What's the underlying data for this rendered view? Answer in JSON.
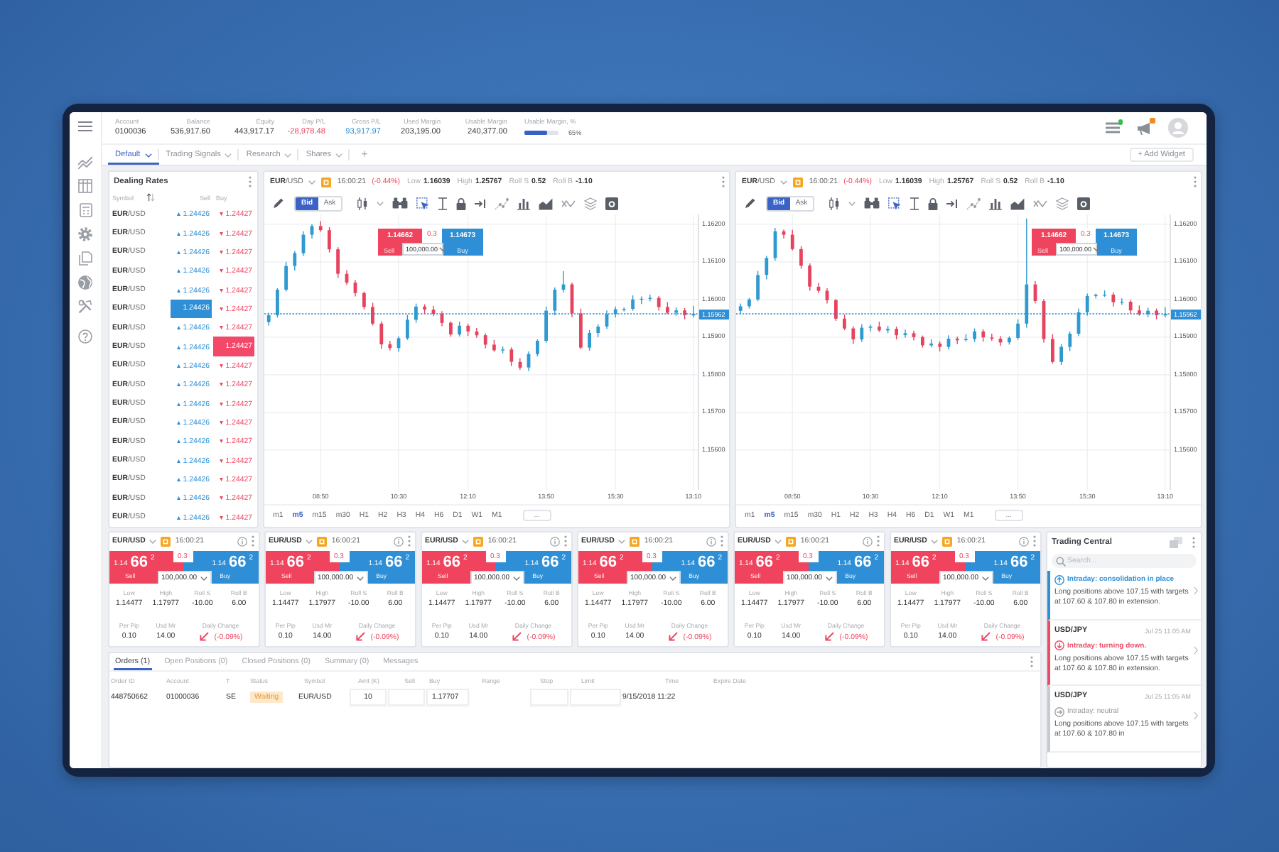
{
  "account_summary": {
    "items": [
      {
        "label": "Account",
        "value": "0100036",
        "color": "#3a3d42"
      },
      {
        "label": "Balance",
        "value": "536,917.60",
        "color": "#3a3d42"
      },
      {
        "label": "Equity",
        "value": "443,917.17",
        "color": "#3a3d42"
      },
      {
        "label": "Day P/L",
        "value": "-28,978.48",
        "color": "#ec4862"
      },
      {
        "label": "Gross P/L",
        "value": "93,917.97",
        "color": "#2f8fd6"
      },
      {
        "label": "Used Margin",
        "value": "203,195.00",
        "color": "#3a3d42"
      },
      {
        "label": "Usable Margin",
        "value": "240,377.00",
        "color": "#3a3d42"
      }
    ],
    "margin_meter": {
      "label": "Usable Margin, %",
      "level": 0.65,
      "reading": "65%"
    }
  },
  "header": {
    "connected": true,
    "unread": true
  },
  "workspace_tabs": [
    {
      "label": "Default",
      "selected": true
    },
    {
      "label": "Trading Signals",
      "selected": false
    },
    {
      "label": "Research",
      "selected": false
    },
    {
      "label": "Shares",
      "selected": false
    }
  ],
  "new_tab": "+",
  "add_widget": "+ Add Widget",
  "dealing_rates": {
    "title": "Dealing Rates",
    "columns": [
      "Symbol",
      "Sell",
      "Buy"
    ],
    "rows": [
      {
        "symbol": "**EUR**/USD",
        "sell": "▴ 1.24426",
        "buy": "▾ 1.24427",
        "sell_highlighted": false,
        "buy_highlighted": false
      },
      {
        "symbol": "**EUR**/USD",
        "sell": "▴ 1.24426",
        "buy": "▾ 1.24427",
        "sell_highlighted": false,
        "buy_highlighted": false
      },
      {
        "symbol": "**EUR**/USD",
        "sell": "▴ 1.24426",
        "buy": "▾ 1.24427",
        "sell_highlighted": false,
        "buy_highlighted": false
      },
      {
        "symbol": "**EUR**/USD",
        "sell": "▴ 1.24426",
        "buy": "▾ 1.24427",
        "sell_highlighted": false,
        "buy_highlighted": false
      },
      {
        "symbol": "**EUR**/USD",
        "sell": "▴ 1.24426",
        "buy": "▾ 1.24427",
        "sell_highlighted": false,
        "buy_highlighted": false
      },
      {
        "symbol": "**EUR**/USD",
        "sell": "1.24426",
        "buy": "▾ 1.24427",
        "sell_highlighted": true,
        "buy_highlighted": false
      },
      {
        "symbol": "**EUR**/USD",
        "sell": "▴ 1.24426",
        "buy": "▾ 1.24427",
        "sell_highlighted": false,
        "buy_highlighted": false
      },
      {
        "symbol": "**EUR**/USD",
        "sell": "▴ 1.24426",
        "buy": "1.24427",
        "sell_highlighted": false,
        "buy_highlighted": true
      },
      {
        "symbol": "**EUR**/USD",
        "sell": "▴ 1.24426",
        "buy": "▾ 1.24427",
        "sell_highlighted": false,
        "buy_highlighted": false
      },
      {
        "symbol": "**EUR**/USD",
        "sell": "▴ 1.24426",
        "buy": "▾ 1.24427",
        "sell_highlighted": false,
        "buy_highlighted": false
      },
      {
        "symbol": "**EUR**/USD",
        "sell": "▴ 1.24426",
        "buy": "▾ 1.24427",
        "sell_highlighted": false,
        "buy_highlighted": false
      },
      {
        "symbol": "**EUR**/USD",
        "sell": "▴ 1.24426",
        "buy": "▾ 1.24427",
        "sell_highlighted": false,
        "buy_highlighted": false
      },
      {
        "symbol": "**EUR**/USD",
        "sell": "▴ 1.24426",
        "buy": "▾ 1.24427",
        "sell_highlighted": false,
        "buy_highlighted": false
      },
      {
        "symbol": "**EUR**/USD",
        "sell": "▴ 1.24426",
        "buy": "▾ 1.24427",
        "sell_highlighted": false,
        "buy_highlighted": false
      },
      {
        "symbol": "**EUR**/USD",
        "sell": "▴ 1.24426",
        "buy": "▾ 1.24427",
        "sell_highlighted": false,
        "buy_highlighted": false
      },
      {
        "symbol": "**EUR**/USD",
        "sell": "▴ 1.24426",
        "buy": "▾ 1.24427",
        "sell_highlighted": false,
        "buy_highlighted": false
      },
      {
        "symbol": "**EUR**/USD",
        "sell": "▴ 1.24426",
        "buy": "▾ 1.24427",
        "sell_highlighted": false,
        "buy_highlighted": false
      }
    ]
  },
  "charts": [
    {
      "pair": "**EUR**/USD",
      "time": "16:00:21",
      "change": {
        "text": "(-0.44%)",
        "falling": true
      },
      "stats": [
        {
          "label": "Low",
          "value": "1.16039"
        },
        {
          "label": "High",
          "value": "1.25767"
        },
        {
          "label": "Roll S",
          "value": "0.52"
        },
        {
          "label": "Roll B",
          "value": "-1.10"
        }
      ],
      "price_types": [
        {
          "label": "Bid",
          "selected": true
        },
        {
          "label": "Ask",
          "selected": false
        }
      ],
      "quote": {
        "sell": "1.14662",
        "spread": "0.3",
        "buy": "1.14673",
        "amount": "100,000.00",
        "sell_label": "Sell",
        "buy_label": "Buy"
      },
      "chart_data": {
        "type": "candlestick",
        "grid": true,
        "categories": [
          null,
          null,
          null,
          null,
          null,
          null,
          "08:50",
          null,
          null,
          null,
          null,
          null,
          null,
          null,
          null,
          "10:30",
          null,
          null,
          null,
          null,
          null,
          null,
          null,
          "12:10",
          null,
          null,
          null,
          null,
          null,
          null,
          null,
          null,
          "13:50",
          null,
          null,
          null,
          null,
          null,
          null,
          null,
          "15:30",
          null,
          null,
          null,
          null,
          null,
          null,
          null,
          null,
          "13:10"
        ],
        "ohlc": [
          [
            1.1594,
            1.15965,
            1.15931,
            1.15958
          ],
          [
            1.15958,
            1.1603,
            1.15952,
            1.16026
          ],
          [
            1.16026,
            1.161,
            1.16021,
            1.16089
          ],
          [
            1.16089,
            1.16129,
            1.16077,
            1.16123
          ],
          [
            1.16123,
            1.16181,
            1.16116,
            1.16172
          ],
          [
            1.16172,
            1.162,
            1.16162,
            1.16195
          ],
          [
            1.16195,
            1.16208,
            1.1618,
            1.16184
          ],
          [
            1.16184,
            1.16192,
            1.16125,
            1.16133
          ],
          [
            1.16133,
            1.16139,
            1.16057,
            1.16068
          ],
          [
            1.16068,
            1.16078,
            1.16039,
            1.16045
          ],
          [
            1.16045,
            1.16052,
            1.16008,
            1.16017
          ],
          [
            1.16017,
            1.16021,
            1.15974,
            1.1598
          ],
          [
            1.1598,
            1.15991,
            1.15931,
            1.15936
          ],
          [
            1.15936,
            1.15942,
            1.15869,
            1.15881
          ],
          [
            1.15881,
            1.1589,
            1.15864,
            1.15871
          ],
          [
            1.15871,
            1.15902,
            1.15861,
            1.15897
          ],
          [
            1.15897,
            1.15959,
            1.15893,
            1.15946
          ],
          [
            1.15946,
            1.15989,
            1.15938,
            1.15981
          ],
          [
            1.15981,
            1.15987,
            1.15962,
            1.15973
          ],
          [
            1.15973,
            1.15983,
            1.15956,
            1.15962
          ],
          [
            1.15962,
            1.15969,
            1.15929,
            1.15938
          ],
          [
            1.15938,
            1.15942,
            1.15901,
            1.15907
          ],
          [
            1.15907,
            1.15941,
            1.15902,
            1.1593
          ],
          [
            1.1593,
            1.15936,
            1.15903,
            1.15915
          ],
          [
            1.15915,
            1.15924,
            1.15898,
            1.15905
          ],
          [
            1.15905,
            1.1591,
            1.1587,
            1.1588
          ],
          [
            1.1588,
            1.15893,
            1.15861,
            1.15865
          ],
          [
            1.15865,
            1.15875,
            1.15857,
            1.15867
          ],
          [
            1.15867,
            1.15873,
            1.15823,
            1.15834
          ],
          [
            1.15834,
            1.15844,
            1.15813,
            1.15819
          ],
          [
            1.15819,
            1.15862,
            1.1581,
            1.15855
          ],
          [
            1.15855,
            1.15894,
            1.15849,
            1.1589
          ],
          [
            1.1589,
            1.15981,
            1.15885,
            1.1597
          ],
          [
            1.1597,
            1.16032,
            1.15958,
            1.16026
          ],
          [
            1.16026,
            1.16075,
            1.16019,
            1.1604
          ],
          [
            1.1604,
            1.16045,
            1.15953,
            1.15963
          ],
          [
            1.15963,
            1.15976,
            1.15868,
            1.15872
          ],
          [
            1.15872,
            1.15919,
            1.15864,
            1.15911
          ],
          [
            1.15911,
            1.15934,
            1.159,
            1.15928
          ],
          [
            1.15928,
            1.15971,
            1.15922,
            1.15961
          ],
          [
            1.15961,
            1.15981,
            1.15952,
            1.15974
          ],
          [
            1.15974,
            1.15979,
            1.15968,
            1.15975
          ],
          [
            1.15975,
            1.16011,
            1.1597,
            1.16
          ],
          [
            1.16,
            1.16008,
            1.15988,
            1.16002
          ],
          [
            1.16002,
            1.16013,
            1.15995,
            1.16004
          ],
          [
            1.16004,
            1.16009,
            1.1597,
            1.1598
          ],
          [
            1.1598,
            1.15993,
            1.15961,
            1.15965
          ],
          [
            1.15965,
            1.15979,
            1.15957,
            1.15971
          ],
          [
            1.15971,
            1.15977,
            1.15947,
            1.15958
          ],
          [
            1.15958,
            1.15983,
            1.15952,
            1.15962
          ]
        ],
        "ylim": [
          1.15494,
          1.16226
        ],
        "yticks": [
          {
            "value": 1.162,
            "label": "1.16200"
          },
          {
            "value": 1.161,
            "label": "1.16100"
          },
          {
            "value": 1.16,
            "label": "1.16000"
          },
          {
            "value": 1.159,
            "label": "1.15900"
          },
          {
            "value": 1.158,
            "label": "1.15800"
          },
          {
            "value": 1.157,
            "label": "1.15700"
          },
          {
            "value": 1.156,
            "label": "1.15600"
          }
        ],
        "ref_lines": [
          {
            "axis": "y",
            "value": 1.15962,
            "label": "1.15962"
          }
        ]
      },
      "timeframes": [
        {
          "label": "m1",
          "selected": false
        },
        {
          "label": "m5",
          "selected": true
        },
        {
          "label": "m15",
          "selected": false
        },
        {
          "label": "m30",
          "selected": false
        },
        {
          "label": "H1",
          "selected": false
        },
        {
          "label": "H2",
          "selected": false
        },
        {
          "label": "H3",
          "selected": false
        },
        {
          "label": "H4",
          "selected": false
        },
        {
          "label": "H6",
          "selected": false
        },
        {
          "label": "D1",
          "selected": false
        },
        {
          "label": "W1",
          "selected": false
        },
        {
          "label": "M1",
          "selected": false
        }
      ],
      "more_timeframes": "..."
    },
    {
      "pair": "**EUR**/USD",
      "time": "16:00:21",
      "change": {
        "text": "(-0.44%)",
        "falling": true
      },
      "stats": [
        {
          "label": "Low",
          "value": "1.16039"
        },
        {
          "label": "High",
          "value": "1.25767"
        },
        {
          "label": "Roll S",
          "value": "0.52"
        },
        {
          "label": "Roll B",
          "value": "-1.10"
        }
      ],
      "price_types": [
        {
          "label": "Bid",
          "selected": true
        },
        {
          "label": "Ask",
          "selected": false
        }
      ],
      "quote": {
        "sell": "1.14662",
        "spread": "0.3",
        "buy": "1.14673",
        "amount": "100,000.00",
        "sell_label": "Sell",
        "buy_label": "Buy"
      },
      "chart_data": {
        "type": "candlestick",
        "grid": true,
        "categories": [
          null,
          null,
          null,
          null,
          null,
          null,
          "08:50",
          null,
          null,
          null,
          null,
          null,
          null,
          null,
          null,
          "10:30",
          null,
          null,
          null,
          null,
          null,
          null,
          null,
          "12:10",
          null,
          null,
          null,
          null,
          null,
          null,
          null,
          null,
          "13:50",
          null,
          null,
          null,
          null,
          null,
          null,
          null,
          "15:30",
          null,
          null,
          null,
          null,
          null,
          null,
          null,
          null,
          "13:10"
        ],
        "ohlc": [
          [
            1.1597,
            1.15989,
            1.15961,
            1.15982
          ],
          [
            1.15982,
            1.16004,
            1.15976,
            1.16
          ],
          [
            1.16,
            1.16076,
            1.15995,
            1.16065
          ],
          [
            1.16065,
            1.16116,
            1.16053,
            1.1611
          ],
          [
            1.1611,
            1.1619,
            1.16103,
            1.16181
          ],
          [
            1.16181,
            1.16186,
            1.16162,
            1.16172
          ],
          [
            1.16172,
            1.16185,
            1.1613,
            1.16134
          ],
          [
            1.16134,
            1.16142,
            1.16082,
            1.1609
          ],
          [
            1.1609,
            1.16096,
            1.16023,
            1.16034
          ],
          [
            1.16034,
            1.16044,
            1.16017,
            1.16023
          ],
          [
            1.16023,
            1.1603,
            1.15989,
            1.15998
          ],
          [
            1.15998,
            1.16002,
            1.15943,
            1.15949
          ],
          [
            1.15949,
            1.1596,
            1.15918,
            1.15923
          ],
          [
            1.15923,
            1.15929,
            1.15882,
            1.15894
          ],
          [
            1.15894,
            1.15934,
            1.15887,
            1.15925
          ],
          [
            1.15925,
            1.15933,
            1.15915,
            1.15928
          ],
          [
            1.15928,
            1.15941,
            1.15914,
            1.15918
          ],
          [
            1.15918,
            1.1593,
            1.1591,
            1.15922
          ],
          [
            1.15922,
            1.15928,
            1.15894,
            1.15905
          ],
          [
            1.15905,
            1.1592,
            1.15899,
            1.1591
          ],
          [
            1.1591,
            1.15917,
            1.15891,
            1.159
          ],
          [
            1.159,
            1.15904,
            1.15872,
            1.15878
          ],
          [
            1.15878,
            1.15894,
            1.15873,
            1.15883
          ],
          [
            1.15883,
            1.15889,
            1.15862,
            1.15874
          ],
          [
            1.15874,
            1.15905,
            1.15867,
            1.15896
          ],
          [
            1.15896,
            1.15901,
            1.15882,
            1.15892
          ],
          [
            1.15892,
            1.15908,
            1.15888,
            1.15895
          ],
          [
            1.15895,
            1.15923,
            1.15887,
            1.15915
          ],
          [
            1.15915,
            1.15921,
            1.15888,
            1.15899
          ],
          [
            1.15899,
            1.15909,
            1.1589,
            1.15896
          ],
          [
            1.15896,
            1.15903,
            1.15877,
            1.15886
          ],
          [
            1.15886,
            1.15902,
            1.1588,
            1.15898
          ],
          [
            1.15898,
            1.15947,
            1.15893,
            1.15936
          ],
          [
            1.15936,
            1.16215,
            1.15925,
            1.1604
          ],
          [
            1.1604,
            1.16049,
            1.15989,
            1.15996
          ],
          [
            1.15996,
            1.16001,
            1.15885,
            1.15895
          ],
          [
            1.15895,
            1.15908,
            1.1583,
            1.15834
          ],
          [
            1.15834,
            1.15882,
            1.15826,
            1.15874
          ],
          [
            1.15874,
            1.15915,
            1.15863,
            1.15909
          ],
          [
            1.15909,
            1.15976,
            1.15903,
            1.15966
          ],
          [
            1.15966,
            1.16016,
            1.15957,
            1.16009
          ],
          [
            1.16009,
            1.16016,
            1.16003,
            1.16012
          ],
          [
            1.16012,
            1.16024,
            1.16007,
            1.16013
          ],
          [
            1.16013,
            1.16019,
            1.15981,
            1.15993
          ],
          [
            1.15993,
            1.16003,
            1.15986,
            1.15994
          ],
          [
            1.15994,
            1.15999,
            1.15961,
            1.15971
          ],
          [
            1.15971,
            1.15984,
            1.15957,
            1.15961
          ],
          [
            1.15961,
            1.15978,
            1.15953,
            1.1597
          ],
          [
            1.1597,
            1.15976,
            1.15947,
            1.15958
          ],
          [
            1.15958,
            1.1598,
            1.15952,
            1.15962
          ]
        ],
        "ylim": [
          1.15494,
          1.16226
        ],
        "yticks": [
          {
            "value": 1.162,
            "label": "1.16200"
          },
          {
            "value": 1.161,
            "label": "1.16100"
          },
          {
            "value": 1.16,
            "label": "1.16000"
          },
          {
            "value": 1.159,
            "label": "1.15900"
          },
          {
            "value": 1.158,
            "label": "1.15800"
          },
          {
            "value": 1.157,
            "label": "1.15700"
          },
          {
            "value": 1.156,
            "label": "1.15600"
          }
        ],
        "ref_lines": [
          {
            "axis": "y",
            "value": 1.15962,
            "label": "1.15962"
          }
        ]
      },
      "timeframes": [
        {
          "label": "m1",
          "selected": false
        },
        {
          "label": "m5",
          "selected": true
        },
        {
          "label": "m15",
          "selected": false
        },
        {
          "label": "m30",
          "selected": false
        },
        {
          "label": "H1",
          "selected": false
        },
        {
          "label": "H2",
          "selected": false
        },
        {
          "label": "H3",
          "selected": false
        },
        {
          "label": "H4",
          "selected": false
        },
        {
          "label": "H6",
          "selected": false
        },
        {
          "label": "D1",
          "selected": false
        },
        {
          "label": "W1",
          "selected": false
        },
        {
          "label": "M1",
          "selected": false
        }
      ],
      "more_timeframes": "..."
    }
  ],
  "tiles": [
    {
      "pair": "EUR/USD",
      "time": "16:00:21",
      "sell": {
        "figure": "1.14",
        "pips": "66",
        "pipette": "2",
        "label": "Sell"
      },
      "spread": "0.3",
      "buy": {
        "figure": "1.14",
        "pips": "66",
        "pipette": "2",
        "label": "Buy"
      },
      "amount": "100,000.00",
      "stats": [
        {
          "label": "Low",
          "value": "1.14477"
        },
        {
          "label": "High",
          "value": "1.17977"
        },
        {
          "label": "Roll S",
          "value": "-10.00"
        },
        {
          "label": "Roll B",
          "value": "6.00"
        },
        {
          "label": "Per Pip",
          "value": "0.10"
        },
        {
          "label": "Usd Mr",
          "value": "14.00"
        }
      ],
      "daily_change": {
        "label": "Daily Change",
        "value": "(-0.09%)",
        "falling": true
      }
    },
    {
      "pair": "EUR/USD",
      "time": "16:00:21",
      "sell": {
        "figure": "1.14",
        "pips": "66",
        "pipette": "2",
        "label": "Sell"
      },
      "spread": "0.3",
      "buy": {
        "figure": "1.14",
        "pips": "66",
        "pipette": "2",
        "label": "Buy"
      },
      "amount": "100,000.00",
      "stats": [
        {
          "label": "Low",
          "value": "1.14477"
        },
        {
          "label": "High",
          "value": "1.17977"
        },
        {
          "label": "Roll S",
          "value": "-10.00"
        },
        {
          "label": "Roll B",
          "value": "6.00"
        },
        {
          "label": "Per Pip",
          "value": "0.10"
        },
        {
          "label": "Usd Mr",
          "value": "14.00"
        }
      ],
      "daily_change": {
        "label": "Daily Change",
        "value": "(-0.09%)",
        "falling": true
      }
    },
    {
      "pair": "EUR/USD",
      "time": "16:00:21",
      "sell": {
        "figure": "1.14",
        "pips": "66",
        "pipette": "2",
        "label": "Sell"
      },
      "spread": "0.3",
      "buy": {
        "figure": "1.14",
        "pips": "66",
        "pipette": "2",
        "label": "Buy"
      },
      "amount": "100,000.00",
      "stats": [
        {
          "label": "Low",
          "value": "1.14477"
        },
        {
          "label": "High",
          "value": "1.17977"
        },
        {
          "label": "Roll S",
          "value": "-10.00"
        },
        {
          "label": "Roll B",
          "value": "6.00"
        },
        {
          "label": "Per Pip",
          "value": "0.10"
        },
        {
          "label": "Usd Mr",
          "value": "14.00"
        }
      ],
      "daily_change": {
        "label": "Daily Change",
        "value": "(-0.09%)",
        "falling": true
      }
    },
    {
      "pair": "EUR/USD",
      "time": "16:00:21",
      "sell": {
        "figure": "1.14",
        "pips": "66",
        "pipette": "2",
        "label": "Sell"
      },
      "spread": "0.3",
      "buy": {
        "figure": "1.14",
        "pips": "66",
        "pipette": "2",
        "label": "Buy"
      },
      "amount": "100,000.00",
      "stats": [
        {
          "label": "Low",
          "value": "1.14477"
        },
        {
          "label": "High",
          "value": "1.17977"
        },
        {
          "label": "Roll S",
          "value": "-10.00"
        },
        {
          "label": "Roll B",
          "value": "6.00"
        },
        {
          "label": "Per Pip",
          "value": "0.10"
        },
        {
          "label": "Usd Mr",
          "value": "14.00"
        }
      ],
      "daily_change": {
        "label": "Daily Change",
        "value": "(-0.09%)",
        "falling": true
      }
    },
    {
      "pair": "EUR/USD",
      "time": "16:00:21",
      "sell": {
        "figure": "1.14",
        "pips": "66",
        "pipette": "2",
        "label": "Sell"
      },
      "spread": "0.3",
      "buy": {
        "figure": "1.14",
        "pips": "66",
        "pipette": "2",
        "label": "Buy"
      },
      "amount": "100,000.00",
      "stats": [
        {
          "label": "Low",
          "value": "1.14477"
        },
        {
          "label": "High",
          "value": "1.17977"
        },
        {
          "label": "Roll S",
          "value": "-10.00"
        },
        {
          "label": "Roll B",
          "value": "6.00"
        },
        {
          "label": "Per Pip",
          "value": "0.10"
        },
        {
          "label": "Usd Mr",
          "value": "14.00"
        }
      ],
      "daily_change": {
        "label": "Daily Change",
        "value": "(-0.09%)",
        "falling": true
      }
    },
    {
      "pair": "EUR/USD",
      "time": "16:00:21",
      "sell": {
        "figure": "1.14",
        "pips": "66",
        "pipette": "2",
        "label": "Sell"
      },
      "spread": "0.3",
      "buy": {
        "figure": "1.14",
        "pips": "66",
        "pipette": "2",
        "label": "Buy"
      },
      "amount": "100,000.00",
      "stats": [
        {
          "label": "Low",
          "value": "1.14477"
        },
        {
          "label": "High",
          "value": "1.17977"
        },
        {
          "label": "Roll S",
          "value": "-10.00"
        },
        {
          "label": "Roll B",
          "value": "6.00"
        },
        {
          "label": "Per Pip",
          "value": "0.10"
        },
        {
          "label": "Usd Mr",
          "value": "14.00"
        }
      ],
      "daily_change": {
        "label": "Daily Change",
        "value": "(-0.09%)",
        "falling": true
      }
    }
  ],
  "orders": {
    "tabs": [
      {
        "label": "Orders (1)",
        "selected": true
      },
      {
        "label": "Open Positions (0)",
        "selected": false
      },
      {
        "label": "Closed Positions (0)",
        "selected": false
      },
      {
        "label": "Summary (0)",
        "selected": false
      },
      {
        "label": "Messages",
        "selected": false
      }
    ],
    "columns": [
      "Order ID",
      "Account",
      "T",
      "Status",
      "Symbol",
      "Amt (K)",
      "Sell",
      "Buy",
      "Range",
      "Stop",
      "Limit",
      "Time",
      "Expire Date"
    ],
    "rows": [
      {
        "cells": [
          {
            "kind": "text",
            "value": "448750662"
          },
          {
            "kind": "text",
            "value": "01000036"
          },
          {
            "kind": "text",
            "value": "SE"
          },
          {
            "kind": "status",
            "value": "Waiting"
          },
          {
            "kind": "text",
            "value": "EUR/USD"
          },
          {
            "kind": "field",
            "value": "10"
          },
          {
            "kind": "field"
          },
          {
            "kind": "field",
            "value": "1.17707"
          },
          {
            "kind": "blank"
          },
          {
            "kind": "field"
          },
          {
            "kind": "field"
          },
          {
            "kind": "text",
            "value": "9/15/2018 11:22"
          },
          {
            "kind": "blank"
          }
        ]
      }
    ]
  },
  "trading_central": {
    "title": "Trading Central",
    "search_placeholder": "Search...",
    "items": [
      {
        "kind": "up",
        "headline": "Intraday: consolidation in place",
        "body": "Long positions above 107.15 with targets at 107.60 & 107.80 in extension."
      },
      {
        "pair": "USD/JPY",
        "time": "Jul 25 11:05 AM",
        "kind": "down",
        "headline": "Intraday: turning down.",
        "body": "Long positions above 107.15 with targets at 107.60 & 107.80 in extension."
      },
      {
        "pair": "USD/JPY",
        "time": "Jul 25 11:05 AM",
        "kind": "neutral",
        "headline": "Intraday: neutral",
        "body": "Long positions above 107.15 with targets at 107.60 & 107.80 in"
      }
    ]
  }
}
